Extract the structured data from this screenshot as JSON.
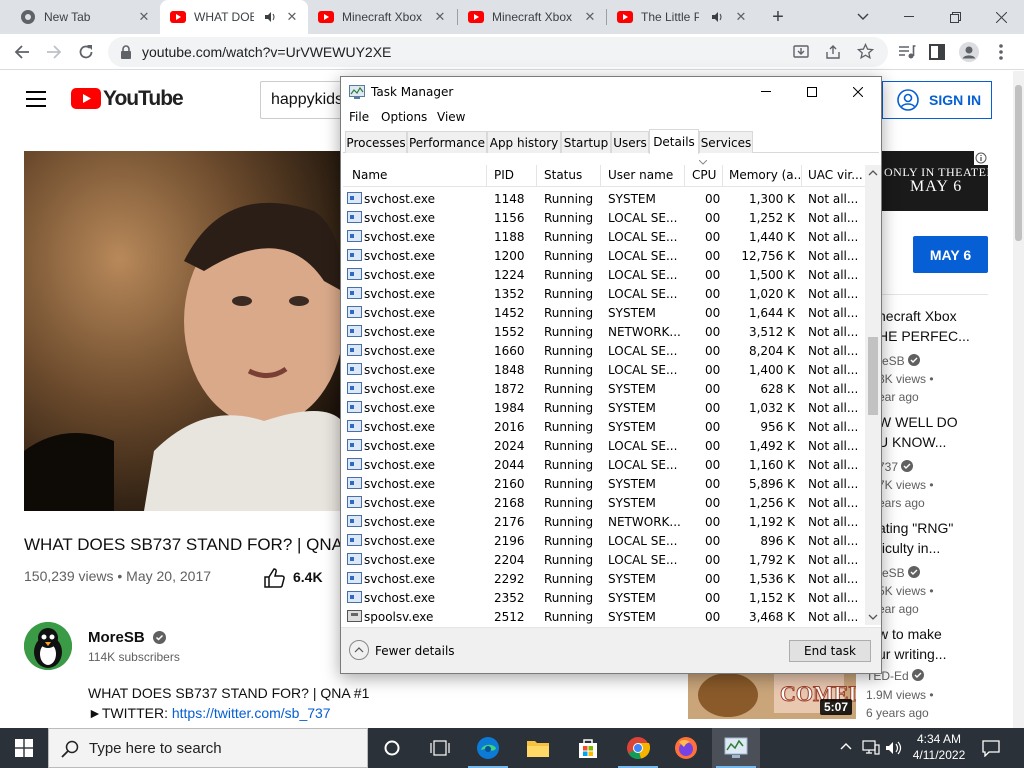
{
  "browser": {
    "tabs": [
      {
        "title": "New Tab",
        "favicon": "chrome-icon"
      },
      {
        "title": "WHAT DOE",
        "favicon": "youtube-icon",
        "audio": true
      },
      {
        "title": "Minecraft Xbox",
        "favicon": "youtube-icon"
      },
      {
        "title": "Minecraft Xbox",
        "favicon": "youtube-icon"
      },
      {
        "title": "The Little P",
        "favicon": "youtube-icon",
        "audio": true
      }
    ],
    "url": "youtube.com/watch?v=UrVWEWUY2XE",
    "accent": "#dee1e6"
  },
  "youtube": {
    "logo_text": "YouTube",
    "search_value": "happykids",
    "signin_label": "SIGN IN",
    "video_title": "WHAT DOES SB737 STAND FOR? | QNA",
    "views": "150,239 views • May 20, 2017",
    "likes": "6.4K",
    "channel_name": "MoreSB",
    "subscribers": "114K subscribers",
    "description_line1": "WHAT DOES SB737 STAND FOR? | QNA #1",
    "description_prefix": "►TWITTER: ",
    "description_link": "https://twitter.com/sb_737",
    "ad": {
      "line1": "ONLY IN THEATERS",
      "line2": "MAY 6",
      "button": "MAY 6"
    },
    "recommendations": [
      {
        "title1": "necraft Xbox",
        "title2": "HE PERFEC...",
        "channel": "reSB",
        "views": "3K views •",
        "age": "ear ago"
      },
      {
        "title1": "W WELL DO",
        "title2": "U KNOW...",
        "channel": "737",
        "views": "7K views •",
        "age": "ears ago"
      },
      {
        "title1": "ating \"RNG\"",
        "title2": "ficulty in...",
        "channel": "reSB",
        "views": "5K views •",
        "age": "ear ago"
      },
      {
        "title1": "w to make",
        "title2": "ur writing...",
        "channel": "TED-Ed",
        "views": "1.9M views •",
        "age": "6 years ago"
      }
    ],
    "thumb_duration": "5:07",
    "brand_red": "#ff0000",
    "link_blue": "#065fd4"
  },
  "task_manager": {
    "title": "Task Manager",
    "menu": [
      "File",
      "Options",
      "View"
    ],
    "tabs": [
      "Processes",
      "Performance",
      "App history",
      "Startup",
      "Users",
      "Details",
      "Services"
    ],
    "active_tab": "Details",
    "columns": [
      "Name",
      "PID",
      "Status",
      "User name",
      "CPU",
      "Memory (a...",
      "UAC vir..."
    ],
    "rows": [
      [
        "svchost.exe",
        "1148",
        "Running",
        "SYSTEM",
        "00",
        "1,300 K",
        "Not all..."
      ],
      [
        "svchost.exe",
        "1156",
        "Running",
        "LOCAL SE...",
        "00",
        "1,252 K",
        "Not all..."
      ],
      [
        "svchost.exe",
        "1188",
        "Running",
        "LOCAL SE...",
        "00",
        "1,440 K",
        "Not all..."
      ],
      [
        "svchost.exe",
        "1200",
        "Running",
        "LOCAL SE...",
        "00",
        "12,756 K",
        "Not all..."
      ],
      [
        "svchost.exe",
        "1224",
        "Running",
        "LOCAL SE...",
        "00",
        "1,500 K",
        "Not all..."
      ],
      [
        "svchost.exe",
        "1352",
        "Running",
        "LOCAL SE...",
        "00",
        "1,020 K",
        "Not all..."
      ],
      [
        "svchost.exe",
        "1452",
        "Running",
        "SYSTEM",
        "00",
        "1,644 K",
        "Not all..."
      ],
      [
        "svchost.exe",
        "1552",
        "Running",
        "NETWORK...",
        "00",
        "3,512 K",
        "Not all..."
      ],
      [
        "svchost.exe",
        "1660",
        "Running",
        "LOCAL SE...",
        "00",
        "8,204 K",
        "Not all..."
      ],
      [
        "svchost.exe",
        "1848",
        "Running",
        "LOCAL SE...",
        "00",
        "1,400 K",
        "Not all..."
      ],
      [
        "svchost.exe",
        "1872",
        "Running",
        "SYSTEM",
        "00",
        "628 K",
        "Not all..."
      ],
      [
        "svchost.exe",
        "1984",
        "Running",
        "SYSTEM",
        "00",
        "1,032 K",
        "Not all..."
      ],
      [
        "svchost.exe",
        "2016",
        "Running",
        "SYSTEM",
        "00",
        "956 K",
        "Not all..."
      ],
      [
        "svchost.exe",
        "2024",
        "Running",
        "LOCAL SE...",
        "00",
        "1,492 K",
        "Not all..."
      ],
      [
        "svchost.exe",
        "2044",
        "Running",
        "LOCAL SE...",
        "00",
        "1,160 K",
        "Not all..."
      ],
      [
        "svchost.exe",
        "2160",
        "Running",
        "SYSTEM",
        "00",
        "5,896 K",
        "Not all..."
      ],
      [
        "svchost.exe",
        "2168",
        "Running",
        "SYSTEM",
        "00",
        "1,256 K",
        "Not all..."
      ],
      [
        "svchost.exe",
        "2176",
        "Running",
        "NETWORK...",
        "00",
        "1,192 K",
        "Not all..."
      ],
      [
        "svchost.exe",
        "2196",
        "Running",
        "LOCAL SE...",
        "00",
        "896 K",
        "Not all..."
      ],
      [
        "svchost.exe",
        "2204",
        "Running",
        "LOCAL SE...",
        "00",
        "1,792 K",
        "Not all..."
      ],
      [
        "svchost.exe",
        "2292",
        "Running",
        "SYSTEM",
        "00",
        "1,536 K",
        "Not all..."
      ],
      [
        "svchost.exe",
        "2352",
        "Running",
        "SYSTEM",
        "00",
        "1,152 K",
        "Not all..."
      ],
      [
        "spoolsv.exe",
        "2512",
        "Running",
        "SYSTEM",
        "00",
        "3,468 K",
        "Not all..."
      ]
    ],
    "fewer_details": "Fewer details",
    "end_task": "End task"
  },
  "taskbar": {
    "search_placeholder": "Type here to search",
    "time": "4:34 AM",
    "date": "4/11/2022",
    "pinned": [
      "task-view-icon",
      "edge-icon",
      "file-explorer-icon",
      "store-icon",
      "chrome-icon",
      "firefox-icon",
      "task-manager-icon"
    ]
  }
}
